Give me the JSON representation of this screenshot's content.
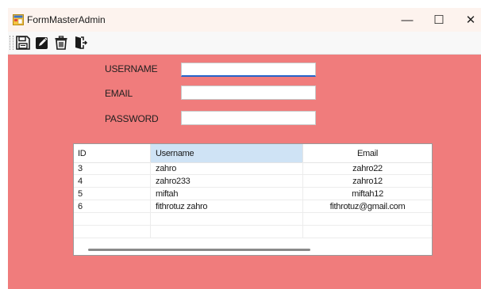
{
  "window": {
    "title": "FormMasterAdmin",
    "minimize": "—",
    "maximize": "☐",
    "close": "✕"
  },
  "toolbar": {
    "icons": [
      "save-icon",
      "edit-icon",
      "delete-icon",
      "exit-icon"
    ]
  },
  "form": {
    "username_label": "USERNAME",
    "username_value": "",
    "email_label": "EMAIL",
    "email_value": "",
    "password_label": "PASSWORD",
    "password_value": ""
  },
  "grid": {
    "columns": [
      "ID",
      "Username",
      "Email"
    ],
    "rows": [
      {
        "id": "3",
        "username": "zahro",
        "email": "zahro22"
      },
      {
        "id": "4",
        "username": "zahro233",
        "email": "zahro12"
      },
      {
        "id": "5",
        "username": "miftah",
        "email": "miftah12"
      },
      {
        "id": "6",
        "username": "fithrotuz zahro",
        "email": "fithrotuz@gmail.com"
      }
    ]
  },
  "colors": {
    "client_background": "#f07c7c",
    "selected_header": "#cfe3f5",
    "focus_underline": "#2563c9"
  }
}
